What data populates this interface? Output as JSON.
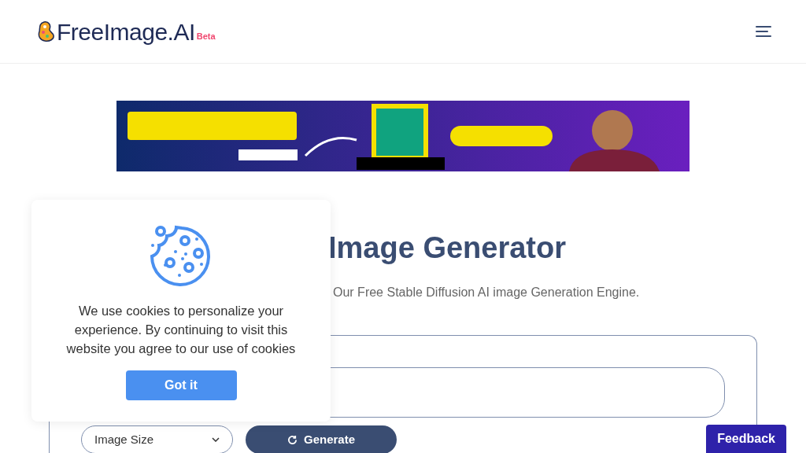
{
  "header": {
    "logo_text": "FreeImage.AI",
    "badge": "Beta"
  },
  "hero": {
    "title": "Image Generator",
    "subtitle": "Our Free Stable Diffusion AI image Generation Engine."
  },
  "form": {
    "size_select": "Image Size",
    "generate_button": "Generate"
  },
  "cookie_notice": {
    "message": "We use cookies to personalize your experience. By continuing to visit this website you agree to our use of cookies",
    "button": "Got it"
  },
  "feedback_button": "Feedback"
}
